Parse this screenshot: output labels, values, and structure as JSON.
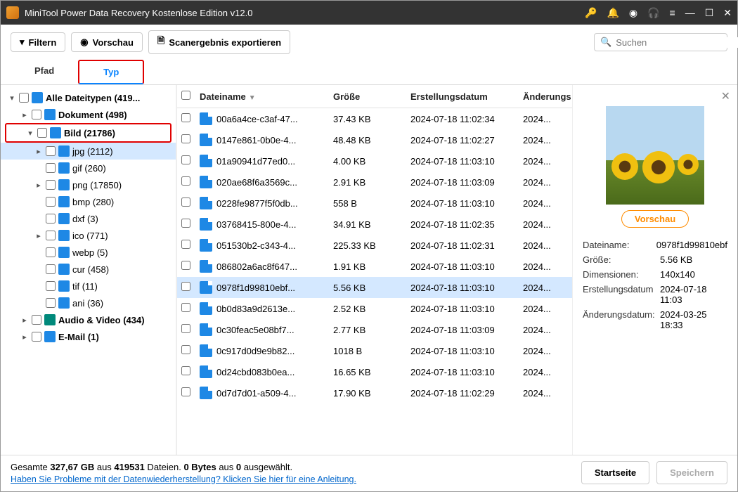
{
  "titlebar": {
    "title": "MiniTool Power Data Recovery Kostenlose Edition v12.0"
  },
  "toolbar": {
    "filter": "Filtern",
    "preview": "Vorschau",
    "export": "Scanergebnis exportieren",
    "search_placeholder": "Suchen"
  },
  "tabs": {
    "path": "Pfad",
    "type": "Typ"
  },
  "tree": {
    "all": "Alle Dateitypen (419...",
    "doc": "Dokument (498)",
    "img": "Bild (21786)",
    "img_children": [
      {
        "k": "jpg",
        "label": "jpg (2112)",
        "sel": true,
        "exp": true
      },
      {
        "k": "gif",
        "label": "gif (260)"
      },
      {
        "k": "png",
        "label": "png (17850)",
        "exp": true
      },
      {
        "k": "bmp",
        "label": "bmp (280)"
      },
      {
        "k": "dxf",
        "label": "dxf (3)"
      },
      {
        "k": "ico",
        "label": "ico (771)",
        "exp": true
      },
      {
        "k": "webp",
        "label": "webp (5)"
      },
      {
        "k": "cur",
        "label": "cur (458)"
      },
      {
        "k": "tif",
        "label": "tif (11)"
      },
      {
        "k": "ani",
        "label": "ani (36)"
      }
    ],
    "audio": "Audio & Video (434)",
    "mail": "E-Mail (1)"
  },
  "columns": {
    "name": "Dateiname",
    "size": "Größe",
    "created": "Erstellungsdatum",
    "modified": "Änderungs"
  },
  "files": [
    {
      "name": "00a6a4ce-c3af-47...",
      "size": "37.43 KB",
      "created": "2024-07-18 11:02:34",
      "mod": "2024..."
    },
    {
      "name": "0147e861-0b0e-4...",
      "size": "48.48 KB",
      "created": "2024-07-18 11:02:27",
      "mod": "2024..."
    },
    {
      "name": "01a90941d77ed0...",
      "size": "4.00 KB",
      "created": "2024-07-18 11:03:10",
      "mod": "2024..."
    },
    {
      "name": "020ae68f6a3569c...",
      "size": "2.91 KB",
      "created": "2024-07-18 11:03:09",
      "mod": "2024..."
    },
    {
      "name": "0228fe9877f5f0db...",
      "size": "558 B",
      "created": "2024-07-18 11:03:10",
      "mod": "2024..."
    },
    {
      "name": "03768415-800e-4...",
      "size": "34.91 KB",
      "created": "2024-07-18 11:02:35",
      "mod": "2024..."
    },
    {
      "name": "051530b2-c343-4...",
      "size": "225.33 KB",
      "created": "2024-07-18 11:02:31",
      "mod": "2024..."
    },
    {
      "name": "086802a6ac8f647...",
      "size": "1.91 KB",
      "created": "2024-07-18 11:03:10",
      "mod": "2024..."
    },
    {
      "name": "0978f1d99810ebf...",
      "size": "5.56 KB",
      "created": "2024-07-18 11:03:10",
      "mod": "2024...",
      "sel": true
    },
    {
      "name": "0b0d83a9d2613e...",
      "size": "2.52 KB",
      "created": "2024-07-18 11:03:10",
      "mod": "2024..."
    },
    {
      "name": "0c30feac5e08bf7...",
      "size": "2.77 KB",
      "created": "2024-07-18 11:03:09",
      "mod": "2024..."
    },
    {
      "name": "0c917d0d9e9b82...",
      "size": "1018 B",
      "created": "2024-07-18 11:03:10",
      "mod": "2024..."
    },
    {
      "name": "0d24cbd083b0ea...",
      "size": "16.65 KB",
      "created": "2024-07-18 11:03:10",
      "mod": "2024..."
    },
    {
      "name": "0d7d7d01-a509-4...",
      "size": "17.90 KB",
      "created": "2024-07-18 11:02:29",
      "mod": "2024..."
    }
  ],
  "preview": {
    "button": "Vorschau",
    "meta": [
      {
        "k": "Dateiname:",
        "v": "0978f1d99810ebf"
      },
      {
        "k": "Größe:",
        "v": "5.56 KB"
      },
      {
        "k": "Dimensionen:",
        "v": "140x140"
      },
      {
        "k": "Erstellungsdatum",
        "v": "2024-07-18 11:03"
      },
      {
        "k": "Änderungsdatum:",
        "v": "2024-03-25 18:33"
      }
    ]
  },
  "footer": {
    "stats_prefix": "Gesamte ",
    "total_size": "327,67 GB",
    "stats_mid1": " aus ",
    "total_files": "419531",
    "stats_mid2": " Dateien.  ",
    "sel_bytes": "0 Bytes",
    "stats_mid3": " aus ",
    "sel_count": "0",
    "stats_suffix": " ausgewählt.",
    "help_link": "Haben Sie Probleme mit der Datenwiederherstellung? Klicken Sie hier für eine Anleitung.",
    "home": "Startseite",
    "save": "Speichern"
  }
}
